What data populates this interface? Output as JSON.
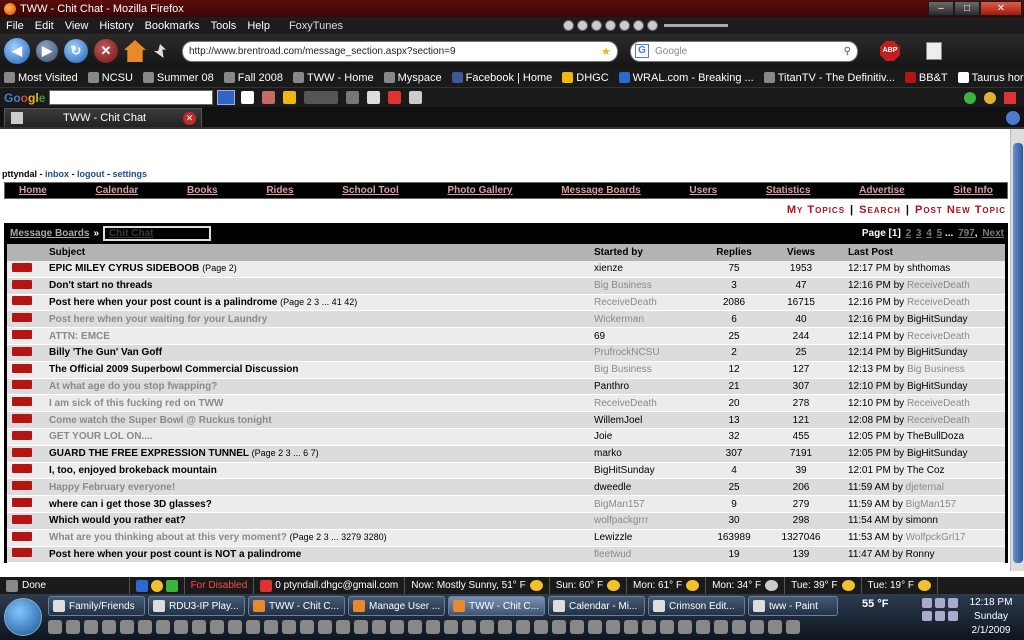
{
  "browser": {
    "title": "TWW - Chit Chat - Mozilla Firefox",
    "menu": [
      "File",
      "Edit",
      "View",
      "History",
      "Bookmarks",
      "Tools",
      "Help"
    ],
    "foxytunes": "FoxyTunes",
    "url": "http://www.brentroad.com/message_section.aspx?section=9",
    "search_placeholder": "Google",
    "abp_label": "ABP",
    "bookmarks": [
      "Most Visited",
      "NCSU",
      "Summer 08",
      "Fall 2008",
      "TWW - Home",
      "Myspace",
      "Facebook | Home",
      "DHGC",
      "WRAL.com - Breaking ...",
      "TitanTV - The Definitiv...",
      "BB&T",
      "Taurus horoscope, fre..."
    ],
    "google_logo": {
      "g1": "Go",
      "g2": "o",
      "g3": "gl",
      "g4": "e"
    },
    "tab_title": "TWW - Chit Chat"
  },
  "page": {
    "user": "pttyndal",
    "user_links": [
      "inbox",
      "logout",
      "settings"
    ],
    "nav": [
      "Home",
      "Calendar",
      "Books",
      "Rides",
      "School Tool",
      "Photo Gallery",
      "Message Boards",
      "Users",
      "Statistics",
      "Advertise",
      "Site Info"
    ],
    "topic_links": [
      "My Topics",
      "Search",
      "Post New Topic"
    ],
    "breadcrumb": {
      "board": "Message Boards",
      "sep": "»",
      "current": "Chit Chat"
    },
    "pager": {
      "prefix": "Page",
      "current": "[1]",
      "pages": [
        "2",
        "3",
        "4",
        "5"
      ],
      "ellipsis": "...",
      "last": "797",
      "next": "Next"
    },
    "columns": {
      "subject": "Subject",
      "started_by": "Started by",
      "replies": "Replies",
      "views": "Views",
      "last_post": "Last Post"
    },
    "topics": [
      {
        "subject": "EPIC MILEY CYRUS SIDEBOOB",
        "pages": "(Page 2)",
        "read": false,
        "by": "xienze",
        "by_grey": false,
        "replies": "75",
        "views": "1953",
        "time": "12:17 PM",
        "last_by": "shthomas",
        "last_grey": false
      },
      {
        "subject": "Don't start no threads",
        "pages": "",
        "read": false,
        "by": "Big Business",
        "by_grey": true,
        "replies": "3",
        "views": "47",
        "time": "12:16 PM",
        "last_by": "ReceiveDeath",
        "last_grey": true
      },
      {
        "subject": "Post here when your post count is a palindrome",
        "pages": "(Page 2 3 ... 41 42)",
        "read": false,
        "by": "ReceiveDeath",
        "by_grey": true,
        "replies": "2086",
        "views": "16715",
        "time": "12:16 PM",
        "last_by": "ReceiveDeath",
        "last_grey": true
      },
      {
        "subject": "Post here when your waiting for your Laundry",
        "pages": "",
        "read": true,
        "by": "Wickerman",
        "by_grey": true,
        "replies": "6",
        "views": "40",
        "time": "12:16 PM",
        "last_by": "BigHitSunday",
        "last_grey": false
      },
      {
        "subject": "ATTN: EMCE",
        "pages": "",
        "read": true,
        "by": "69",
        "by_grey": false,
        "replies": "25",
        "views": "244",
        "time": "12:14 PM",
        "last_by": "ReceiveDeath",
        "last_grey": true
      },
      {
        "subject": "Billy 'The Gun' Van Goff",
        "pages": "",
        "read": false,
        "by": "PrufrockNCSU",
        "by_grey": true,
        "replies": "2",
        "views": "25",
        "time": "12:14 PM",
        "last_by": "BigHitSunday",
        "last_grey": false
      },
      {
        "subject": "The Official 2009 Superbowl Commercial Discussion",
        "pages": "",
        "read": false,
        "by": "Big Business",
        "by_grey": true,
        "replies": "12",
        "views": "127",
        "time": "12:13 PM",
        "last_by": "Big Business",
        "last_grey": true
      },
      {
        "subject": "At what age do you stop fwapping?",
        "pages": "",
        "read": true,
        "by": "Panthro",
        "by_grey": false,
        "replies": "21",
        "views": "307",
        "time": "12:10 PM",
        "last_by": "BigHitSunday",
        "last_grey": false
      },
      {
        "subject": "I am sick of this fucking red on TWW",
        "pages": "",
        "read": true,
        "by": "ReceiveDeath",
        "by_grey": true,
        "replies": "20",
        "views": "278",
        "time": "12:10 PM",
        "last_by": "ReceiveDeath",
        "last_grey": true
      },
      {
        "subject": "Come watch the Super Bowl @ Ruckus tonight",
        "pages": "",
        "read": true,
        "by": "WillemJoel",
        "by_grey": false,
        "replies": "13",
        "views": "121",
        "time": "12:08 PM",
        "last_by": "ReceiveDeath",
        "last_grey": true
      },
      {
        "subject": "GET YOUR LOL ON....",
        "pages": "",
        "read": true,
        "by": "Joie",
        "by_grey": false,
        "replies": "32",
        "views": "455",
        "time": "12:05 PM",
        "last_by": "TheBullDoza",
        "last_grey": false
      },
      {
        "subject": "GUARD THE FREE EXPRESSION TUNNEL",
        "pages": "(Page 2 3 ... 6 7)",
        "read": false,
        "by": "marko",
        "by_grey": false,
        "replies": "307",
        "views": "7191",
        "time": "12:05 PM",
        "last_by": "BigHitSunday",
        "last_grey": false
      },
      {
        "subject": "I, too, enjoyed brokeback mountain",
        "pages": "",
        "read": false,
        "by": "BigHitSunday",
        "by_grey": false,
        "replies": "4",
        "views": "39",
        "time": "12:01 PM",
        "last_by": "The Coz",
        "last_grey": false
      },
      {
        "subject": "Happy February everyone!",
        "pages": "",
        "read": true,
        "by": "dweedle",
        "by_grey": false,
        "replies": "25",
        "views": "206",
        "time": "11:59 AM",
        "last_by": "djeternal",
        "last_grey": true
      },
      {
        "subject": "where can i get those 3D glasses?",
        "pages": "",
        "read": false,
        "by": "BigMan157",
        "by_grey": true,
        "replies": "9",
        "views": "279",
        "time": "11:59 AM",
        "last_by": "BigMan157",
        "last_grey": true
      },
      {
        "subject": "Which would you rather eat?",
        "pages": "",
        "read": false,
        "by": "wolfpackgrrr",
        "by_grey": true,
        "replies": "30",
        "views": "298",
        "time": "11:54 AM",
        "last_by": "simonn",
        "last_grey": false
      },
      {
        "subject": "What are you thinking about at this very moment?",
        "pages": "(Page 2 3 ... 3279 3280)",
        "read": true,
        "by": "Lewizzle",
        "by_grey": false,
        "replies": "163989",
        "views": "1327046",
        "time": "11:53 AM",
        "last_by": "WolfpckGrl17",
        "last_grey": true
      },
      {
        "subject": "Post here when your post count is NOT a palindrome",
        "pages": "",
        "read": false,
        "by": "fleetwud",
        "by_grey": true,
        "replies": "19",
        "views": "139",
        "time": "11:47 AM",
        "last_by": "Ronny",
        "last_grey": false
      }
    ],
    "by_word": "by"
  },
  "statusbar": {
    "done": "Done",
    "disabled": "For Disabled",
    "email": "0 ptyndall.dhgc@gmail.com",
    "now": "Now: Mostly Sunny, 51° F",
    "sun": "Sun: 60° F",
    "mon": "Mon: 61° F",
    "mon2": "Mon: 34° F",
    "tue": "Tue: 39° F",
    "tue2": "Tue: 19° F"
  },
  "taskbar": {
    "tasks": [
      "Family/Friends",
      "RDU3-IP Play...",
      "TWW - Chit C...",
      "Manage User ...",
      "TWW - Chit C...",
      "Calendar - Mi...",
      "Crimson Edit...",
      "tww - Paint"
    ],
    "active_index": 4,
    "temp": "55 °F",
    "clock": {
      "time": "12:18 PM",
      "day": "Sunday",
      "date": "2/1/2009"
    }
  }
}
